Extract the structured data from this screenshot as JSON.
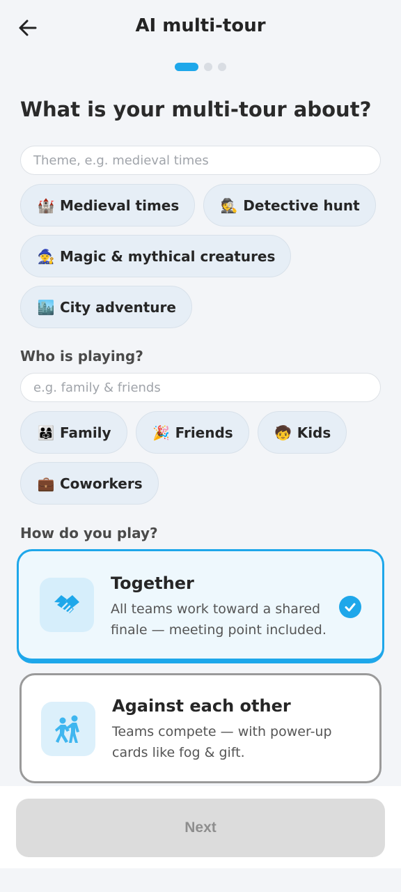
{
  "header": {
    "title": "AI multi-tour",
    "back_icon": "arrow-left-icon"
  },
  "progress": {
    "current_step": 1,
    "total_steps": 3
  },
  "theme_section": {
    "question": "What is your multi-tour about?",
    "input_placeholder": "Theme, e.g. medieval times",
    "input_value": "",
    "chips": [
      {
        "emoji": "🏰",
        "label": "Medieval times"
      },
      {
        "emoji": "🕵️",
        "label": "Detective hunt"
      },
      {
        "emoji": "🧙",
        "label": "Magic & mythical creatures"
      },
      {
        "emoji": "🏙️",
        "label": "City adventure"
      }
    ]
  },
  "players_section": {
    "label": "Who is playing?",
    "input_placeholder": "e.g. family & friends",
    "input_value": "",
    "chips": [
      {
        "emoji": "👨‍👩‍👧",
        "label": "Family"
      },
      {
        "emoji": "🎉",
        "label": "Friends"
      },
      {
        "emoji": "🧒",
        "label": "Kids"
      },
      {
        "emoji": "💼",
        "label": "Coworkers"
      }
    ]
  },
  "play_section": {
    "label": "How do you play?",
    "options": [
      {
        "title": "Together",
        "description": "All teams work toward a shared finale — meeting point included.",
        "icon": "handshake-icon",
        "selected": true
      },
      {
        "title": "Against each other",
        "description": "Teams compete — with power-up cards like fog & gift.",
        "icon": "competing-players-icon",
        "selected": false
      }
    ]
  },
  "footer": {
    "next_label": "Next",
    "next_enabled": false
  },
  "colors": {
    "accent": "#1ea7ea",
    "chip_bg": "#e6eef6",
    "disabled_button": "#dcdcdc"
  }
}
